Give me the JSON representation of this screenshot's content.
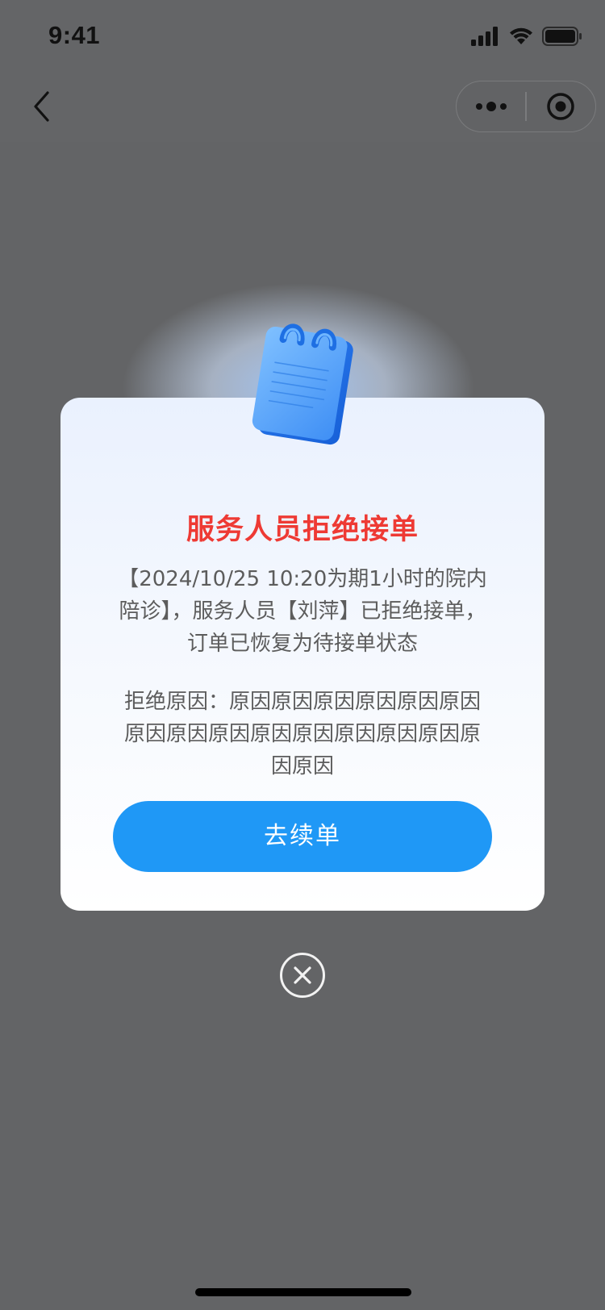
{
  "status_bar": {
    "time": "9:41",
    "icons": [
      "signal-icon",
      "wifi-icon",
      "battery-icon"
    ]
  },
  "nav": {
    "back_icon": "chevron-left-icon",
    "capsule_icons": [
      "more-dots-icon",
      "target-icon"
    ]
  },
  "dialog": {
    "title": "服务人员拒绝接单",
    "message": "【2024/10/25 10:20为期1小时的院内陪诊】，服务人员【刘萍】已拒绝接单，订单已恢复为待接单状态",
    "reason": "拒绝原因：原因原因原因原因原因原因原因原因原因原因原因原因原因原因原因原因",
    "button_label": "去续单",
    "icon": "notebook-icon"
  },
  "close_icon": "close-circle-icon",
  "colors": {
    "title_red": "#ee3a34",
    "button_blue": "#1f98f6",
    "overlay": "#636466"
  }
}
